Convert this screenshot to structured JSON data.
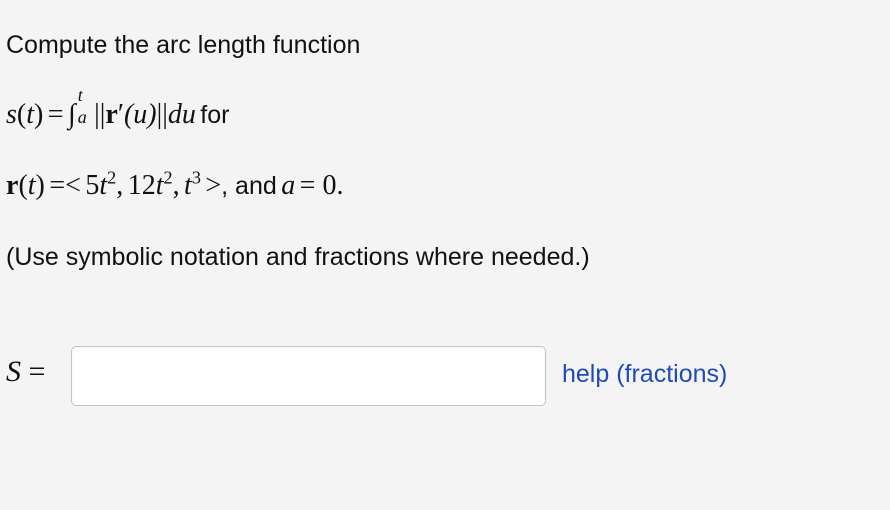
{
  "problem": {
    "intro": "Compute the arc length function",
    "formula": {
      "s_lhs": "s",
      "t_var": "t",
      "equals": "=",
      "integral_sign": "∫",
      "upper_limit": "t",
      "lower_limit": "a",
      "norm_open": "||",
      "r_bold": "r",
      "prime": "′",
      "u_arg": "(u)",
      "norm_close": "||",
      "du": "du",
      "for_word": "for"
    },
    "vector": {
      "r_bold": "r",
      "open": "=<",
      "comp1_coef": "5",
      "comp1_exp": "2",
      "comp2_coef": "12",
      "comp2_exp": "2",
      "comp3_exp": "3",
      "close": ">",
      "and_text": ", and",
      "a_var": "a",
      "a_value": "= 0."
    },
    "note": "(Use symbolic notation and fractions where needed.)"
  },
  "answer": {
    "label_var": "S",
    "label_eq": "=",
    "value": "",
    "placeholder": ""
  },
  "help_link": {
    "label": "help (fractions)"
  },
  "colors": {
    "background": "#f4f4f4",
    "link": "#1f4bb6",
    "input_border": "#c4c4c4"
  }
}
